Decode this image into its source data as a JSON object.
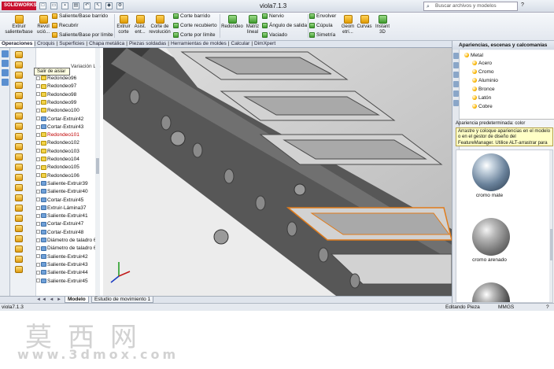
{
  "app": {
    "logo": "SOLIDWORKS",
    "doc_title": "viola7.1.3",
    "search_placeholder": "Buscar archivos y modelos",
    "help": "?"
  },
  "commands": {
    "extruir_saliente": "Extruir saliente/base",
    "revolucion_saliente": "Revol ució...",
    "saliente_barrido": "Saliente/Base barrido",
    "recubrir": "Recubrir",
    "saliente_limite": "Saliente/Base por límite",
    "extruir_corte": "Extruir corte",
    "asist_taladro": "Asist. ent...",
    "corte_revolucion": "Corte de revolución",
    "corte_barrido": "Corte barrido",
    "corte_recubierto": "Corte recubierto",
    "corte_limite": "Corte por límite",
    "redondeo": "Redondeo",
    "matriz_lineal": "Matriz lineal",
    "nervio": "Nervio",
    "angulo_salida": "Ángulo de salida",
    "vaciado": "Vaciado",
    "envolver": "Envolver",
    "cupula": "Cúpula",
    "simetria": "Simetría",
    "geom_ref": "Geom etrí...",
    "curvas": "Curvas",
    "instant3d": "Instant 3D"
  },
  "tabs": [
    "Operaciones",
    "Croquis",
    "Superficies",
    "Chapa metálica",
    "Piezas soldadas",
    "Herramientas de moldes",
    "Calcular",
    "DimXpert"
  ],
  "tooltip": "Salir de aislar",
  "tree": {
    "header": "Variación Lín",
    "items": [
      {
        "label": "Redondeo96",
        "kind": "fillet"
      },
      {
        "label": "Redondeo97",
        "kind": "fillet"
      },
      {
        "label": "Redondeo98",
        "kind": "fillet"
      },
      {
        "label": "Redondeo99",
        "kind": "fillet"
      },
      {
        "label": "Redondeo100",
        "kind": "fillet"
      },
      {
        "label": "Cortar-Extruir42",
        "kind": "cut"
      },
      {
        "label": "Cortar-Extruir43",
        "kind": "cut"
      },
      {
        "label": "Redondeo101",
        "kind": "fillet",
        "error": true
      },
      {
        "label": "Redondeo102",
        "kind": "fillet"
      },
      {
        "label": "Redondeo103",
        "kind": "fillet"
      },
      {
        "label": "Redondeo104",
        "kind": "fillet"
      },
      {
        "label": "Redondeo105",
        "kind": "fillet"
      },
      {
        "label": "Redondeo106",
        "kind": "fillet"
      },
      {
        "label": "Saliente-Extruir39",
        "kind": "boss"
      },
      {
        "label": "Saliente-Extruir40",
        "kind": "boss"
      },
      {
        "label": "Cortar-Extruir45",
        "kind": "cut"
      },
      {
        "label": "Extruir-Lámina37",
        "kind": "boss"
      },
      {
        "label": "Saliente-Extruir41",
        "kind": "boss"
      },
      {
        "label": "Cortar-Extruir47",
        "kind": "cut"
      },
      {
        "label": "Cortar-Extruir48",
        "kind": "cut"
      },
      {
        "label": "Diámetro de taladro 6",
        "kind": "hole"
      },
      {
        "label": "Diámetro de taladro 6",
        "kind": "hole"
      },
      {
        "label": "Saliente-Extruir42",
        "kind": "boss"
      },
      {
        "label": "Saliente-Extruir43",
        "kind": "boss"
      },
      {
        "label": "Saliente-Extruir44",
        "kind": "boss"
      },
      {
        "label": "Saliente-Extruir45",
        "kind": "boss"
      }
    ]
  },
  "bottom_tabs": {
    "nav": "◄◄ ◄ ► ►►",
    "modelo": "Modelo",
    "estudio": "Estudio de movimiento 1"
  },
  "status": {
    "file": "viola7.1.3",
    "mode": "Editando Pieza",
    "units": "MMGS",
    "help": "?"
  },
  "taskpane": {
    "title": "Apariencias, escenas y calcomanías",
    "metal_folder": "Metal",
    "materials": [
      "Acero",
      "Cromo",
      "Aluminio",
      "Bronce",
      "Latón",
      "Cobre"
    ],
    "pref_label": "Apariencia predeterminada: color",
    "help_text": "Arrastre y coloque apariencias en el modelo o en el gestor de diseño del FeatureManager. Utilice ALT-arrastrar para editar inmediatam...",
    "swatches": [
      "cromo mate",
      "cromo arenado"
    ]
  },
  "watermark": {
    "cn": "莫西网",
    "url": "www.3dmox.com"
  },
  "colors": {
    "selection": "#e07b1a",
    "error": "#c00000",
    "model": "#6e6e6e"
  }
}
